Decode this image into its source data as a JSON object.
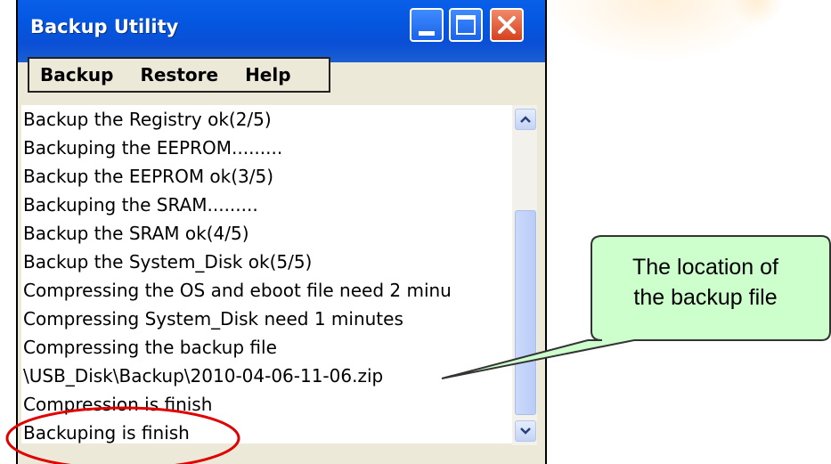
{
  "window": {
    "title": "Backup Utility",
    "buttons": {
      "minimize": "minimize-icon",
      "maximize": "maximize-icon",
      "close": "close-icon"
    },
    "close_color": "#d6411e",
    "titlebar_color": "#0457e0"
  },
  "menu": {
    "items": [
      "Backup",
      "Restore",
      "Help"
    ]
  },
  "log": {
    "lines": [
      "Backup the Registry ok(2/5)",
      "Backuping the EEPROM.........",
      "Backup the EEPROM ok(3/5)",
      "Backuping the SRAM.........",
      "Backup the SRAM ok(4/5)",
      "Backup the System_Disk ok(5/5)",
      "Compressing the OS and eboot file need 2 minu",
      "Compressing System_Disk need 1 minutes",
      "Compressing the backup file",
      "\\USB_Disk\\Backup\\2010-04-06-11-06.zip",
      "Compression is finish",
      "Backuping is finish"
    ]
  },
  "callout": {
    "line1": "The location of",
    "line2": "the backup file",
    "fill_color": "#ccffcc"
  },
  "highlight": {
    "ellipse_color": "#e00000"
  }
}
